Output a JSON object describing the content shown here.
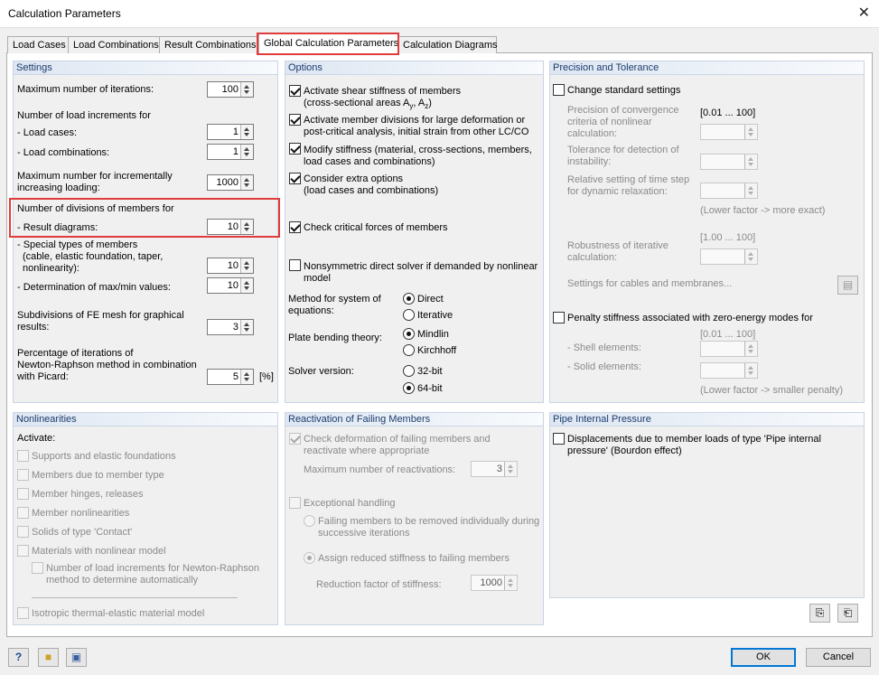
{
  "window": {
    "title": "Calculation Parameters",
    "close": "✕"
  },
  "tabs": [
    "Load Cases",
    "Load Combinations",
    "Result Combinations",
    "Global Calculation Parameters",
    "Calculation Diagrams"
  ],
  "settings": {
    "header": "Settings",
    "max_iter_label": "Maximum number of iterations:",
    "max_iter_value": "100",
    "load_incr_label": "Number of load increments for",
    "load_cases_label": "- Load cases:",
    "load_cases_value": "1",
    "load_combos_label": "- Load combinations:",
    "load_combos_value": "1",
    "max_incr_label1": "Maximum number for incrementally",
    "max_incr_label2": "increasing loading:",
    "max_incr_value": "1000",
    "divisions_label": "Number of divisions of members for",
    "result_diagrams_label": "- Result diagrams:",
    "result_diagrams_value": "10",
    "special_label1": "- Special types of members",
    "special_label2": "(cable, elastic foundation, taper,",
    "special_label3": "nonlinearity):",
    "special_value": "10",
    "maxmin_label": "- Determination of max/min values:",
    "maxmin_value": "10",
    "subdiv_label1": "Subdivisions of FE mesh for graphical",
    "subdiv_label2": "results:",
    "subdiv_value": "3",
    "pct_label1": "Percentage of iterations of",
    "pct_label2": "Newton-Raphson method in combination",
    "pct_label3": "with Picard:",
    "pct_value": "5",
    "pct_unit": "[%]"
  },
  "options": {
    "header": "Options",
    "shear1": "Activate shear stiffness of members",
    "shear2": "(cross-sectional areas A",
    "shear_y": "y",
    "shear_sep": ", A",
    "shear_z": "z",
    "shear_end": ")",
    "div1": "Activate member divisions for large deformation or",
    "div2": "post-critical analysis, initial strain from other LC/CO",
    "mod1": "Modify stiffness (material, cross-sections, members,",
    "mod2": "load cases and combinations)",
    "extra1": "Consider extra options",
    "extra2": "(load cases and combinations)",
    "critical": "Check critical forces of members",
    "nonsym1": "Nonsymmetric direct solver if demanded by nonlinear",
    "nonsym2": "model",
    "method1": "Method for system of",
    "method2": "equations:",
    "direct": "Direct",
    "iterative": "Iterative",
    "plate": "Plate bending theory:",
    "mindlin": "Mindlin",
    "kirchhoff": "Kirchhoff",
    "solver": "Solver version:",
    "bit32": "32-bit",
    "bit64": "64-bit"
  },
  "precision": {
    "header": "Precision and Tolerance",
    "change": "Change standard settings",
    "conv1": "Precision of convergence",
    "conv2": "criteria of nonlinear",
    "conv3": "calculation:",
    "conv_range": "[0.01 ... 100]",
    "instab1": "Tolerance for detection of",
    "instab2": "instability:",
    "relax1": "Relative setting of time step",
    "relax2": "for dynamic relaxation:",
    "lower_more": "(Lower factor -> more exact)",
    "robust_range": "[1.00 ... 100]",
    "robust1": "Robustness of iterative",
    "robust2": "calculation:",
    "cables": "Settings for cables and membranes...",
    "penalty": "Penalty stiffness associated with zero-energy modes for",
    "penalty_range": "[0.01 ... 100]",
    "shell": "- Shell elements:",
    "solid": "- Solid elements:",
    "lower_penalty": "(Lower factor -> smaller penalty)"
  },
  "nonlin": {
    "header": "Nonlinearities",
    "activate": "Activate:",
    "supports": "Supports and elastic foundations",
    "member_type": "Members due to member type",
    "hinges": "Member hinges, releases",
    "mem_nonlin": "Member nonlinearities",
    "contact": "Solids of type 'Contact'",
    "materials": "Materials with nonlinear model",
    "nr1": "Number of load increments for Newton-Raphson",
    "nr2": "method to determine automatically",
    "iso": "Isotropic thermal-elastic material model"
  },
  "reactivation": {
    "header": "Reactivation of Failing Members",
    "check1": "Check deformation of failing members and",
    "check2": "reactivate where appropriate",
    "max_label": "Maximum number of reactivations:",
    "max_value": "3",
    "exceptional": "Exceptional handling",
    "remove1": "Failing members to be removed individually during",
    "remove2": "successive iterations",
    "reduced": "Assign reduced stiffness to failing members",
    "factor_label": "Reduction factor of stiffness:",
    "factor_value": "1000"
  },
  "pipe": {
    "header": "Pipe Internal Pressure",
    "disp1": "Displacements due to member loads of type 'Pipe internal",
    "disp2": "pressure' (Bourdon effect)"
  },
  "footer": {
    "ok": "OK",
    "cancel": "Cancel"
  }
}
